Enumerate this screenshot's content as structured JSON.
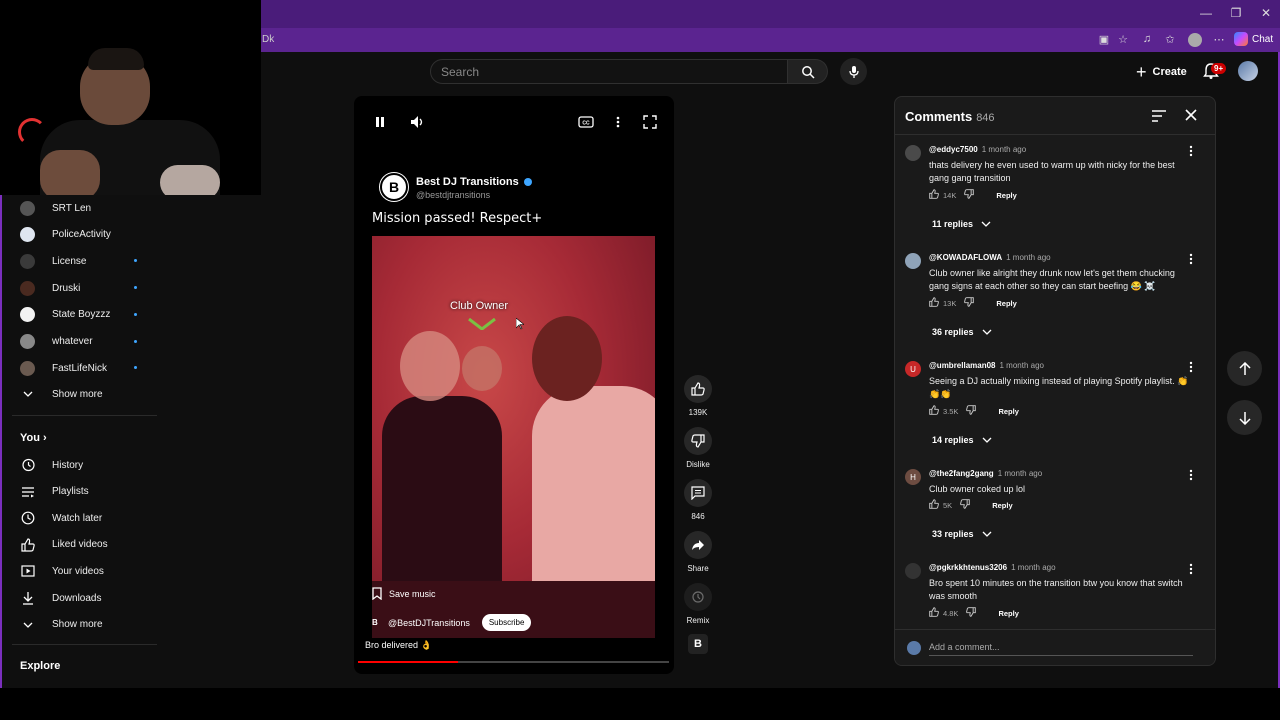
{
  "browser": {
    "address_fragment": "Dk",
    "chat_label": "Chat",
    "window_controls": [
      "—",
      "❐",
      "✕"
    ]
  },
  "header": {
    "search_placeholder": "Search",
    "create_label": "Create",
    "notification_count": "9+"
  },
  "sidebar": {
    "subscriptions": [
      {
        "label": "SRT Len",
        "avatar_color": "#555555",
        "new": false
      },
      {
        "label": "PoliceActivity",
        "avatar_color": "#dfe6f0",
        "new": false
      },
      {
        "label": "License",
        "avatar_color": "#3a3a3a",
        "new": true
      },
      {
        "label": "Druski",
        "avatar_color": "#4a2a20",
        "new": true
      },
      {
        "label": "State Boyzzz",
        "avatar_color": "#f2f2f2",
        "new": true
      },
      {
        "label": "whatever",
        "avatar_color": "#888888",
        "new": true
      },
      {
        "label": "FastLifeNick",
        "avatar_color": "#6a5a50",
        "new": true
      }
    ],
    "show_more": "Show more",
    "you_heading": "You",
    "you_items": [
      {
        "label": "History",
        "icon": "history-icon"
      },
      {
        "label": "Playlists",
        "icon": "playlists-icon"
      },
      {
        "label": "Watch later",
        "icon": "watch-later-icon"
      },
      {
        "label": "Liked videos",
        "icon": "liked-videos-icon"
      },
      {
        "label": "Your videos",
        "icon": "your-videos-icon"
      },
      {
        "label": "Downloads",
        "icon": "downloads-icon"
      },
      {
        "label": "Show more",
        "icon": "chevron-down-icon"
      }
    ],
    "explore_heading": "Explore"
  },
  "short": {
    "channel_name": "Best DJ Transitions",
    "channel_handle": "@bestdjtransitions",
    "overlay_title": "Mission passed! Respect+",
    "overlay_label": "Club Owner",
    "save_music": "Save music",
    "uploader_handle": "@BestDJTransitions",
    "subscribe_label": "Subscribe",
    "caption": "Bro delivered 👌",
    "progress": 0.32,
    "logo_letter": "B"
  },
  "actions": {
    "likes": "139K",
    "dislike_label": "Dislike",
    "comments": "846",
    "share_label": "Share",
    "remix_label": "Remix"
  },
  "comments": {
    "title": "Comments",
    "count": "846",
    "add_placeholder": "Add a comment...",
    "reply_label": "Reply",
    "items": [
      {
        "author": "@eddyc7500",
        "time": "1 month ago",
        "text": "thats delivery he even used to warm up with nicky for the best gang gang transition",
        "likes": "14K",
        "replies": "11 replies",
        "avatar_color": "#4a4a4a",
        "avatar_letter": ""
      },
      {
        "author": "@KOWADAFLOWA",
        "time": "1 month ago",
        "text": "Club owner like alright they drunk now let's get them chucking gang signs at each other so they can start beefing 😂 ☠️",
        "likes": "13K",
        "replies": "36 replies",
        "avatar_color": "#8fa3b8",
        "avatar_letter": ""
      },
      {
        "author": "@umbrellaman08",
        "time": "1 month ago",
        "text": "Seeing a DJ actually mixing instead of playing Spotify playlist. 👏👏👏",
        "likes": "3.5K",
        "replies": "14 replies",
        "avatar_color": "#c62828",
        "avatar_letter": "U"
      },
      {
        "author": "@the2fang2gang",
        "time": "1 month ago",
        "text": "Club owner coked up lol",
        "likes": "5K",
        "replies": "33 replies",
        "avatar_color": "#6d4c41",
        "avatar_letter": "H"
      },
      {
        "author": "@pgkrkkhtenus3206",
        "time": "1 month ago",
        "text": "Bro spent 10 minutes on the transition btw you know that switch was smooth",
        "likes": "4.8K",
        "replies": "",
        "avatar_color": "#333333",
        "avatar_letter": ""
      }
    ]
  }
}
